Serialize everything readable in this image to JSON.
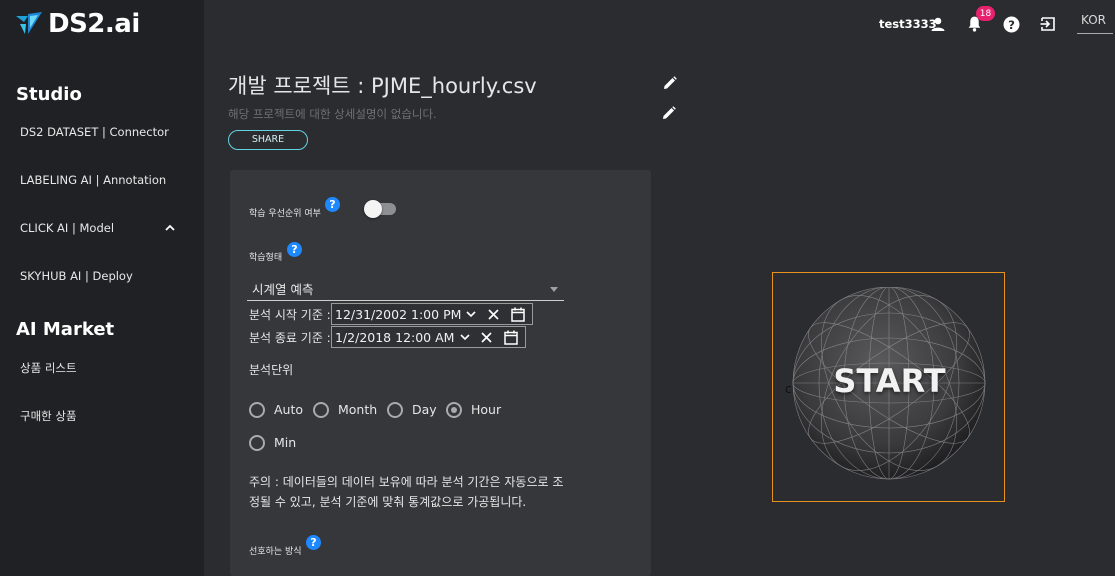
{
  "brand": {
    "name": "DS2.ai",
    "logo_icon": "ds2-logo-icon",
    "accent": "#1ea2d8"
  },
  "sidebar": {
    "sections": [
      {
        "title": "Studio",
        "items": [
          {
            "label": "DS2 DATASET | Connector"
          },
          {
            "label": "LABELING AI | Annotation"
          },
          {
            "label": "CLICK AI | Model",
            "icon": "chevron-up-icon"
          },
          {
            "label": "SKYHUB AI | Deploy"
          }
        ]
      },
      {
        "title": "AI Market",
        "items": [
          {
            "label": "상품 리스트"
          },
          {
            "label": "구매한 상품"
          }
        ]
      }
    ]
  },
  "header": {
    "username": "test3333",
    "notification_count": "18",
    "language": "KOR",
    "icons": [
      "user-icon",
      "bell-icon",
      "help-icon",
      "logout-icon"
    ]
  },
  "project": {
    "title": "개발 프로젝트 : PJME_hourly.csv",
    "description": "해당 프로젝트에 대한 상세설명이 없습니다.",
    "share_label": "SHARE"
  },
  "form": {
    "priority_label": "학습 우선순위 여부",
    "priority_enabled": false,
    "train_type_label": "학습형태",
    "train_type_value": "시계열 예측",
    "start_label": "분석 시작 기준 :",
    "start_value": "12/31/2002 1:00  PM",
    "end_label": "분석 종료 기준 :",
    "end_value": "1/2/2018 12:00  AM",
    "unit_label": "분석단위",
    "units": [
      {
        "label": "Auto",
        "checked": false
      },
      {
        "label": "Month",
        "checked": false
      },
      {
        "label": "Day",
        "checked": false
      },
      {
        "label": "Hour",
        "checked": true
      },
      {
        "label": "Min",
        "checked": false
      }
    ],
    "note": "주의 : 데이터들의 데이터 보유에 따라 분석 기간은 자동으로 조정될 수 있고, 분석 기준에 맞춰 통계값으로 가공됩니다.",
    "preference_label": "선호하는 방식"
  },
  "start": {
    "label": "START",
    "side_char": "c",
    "frame_color": "#e8911e"
  }
}
